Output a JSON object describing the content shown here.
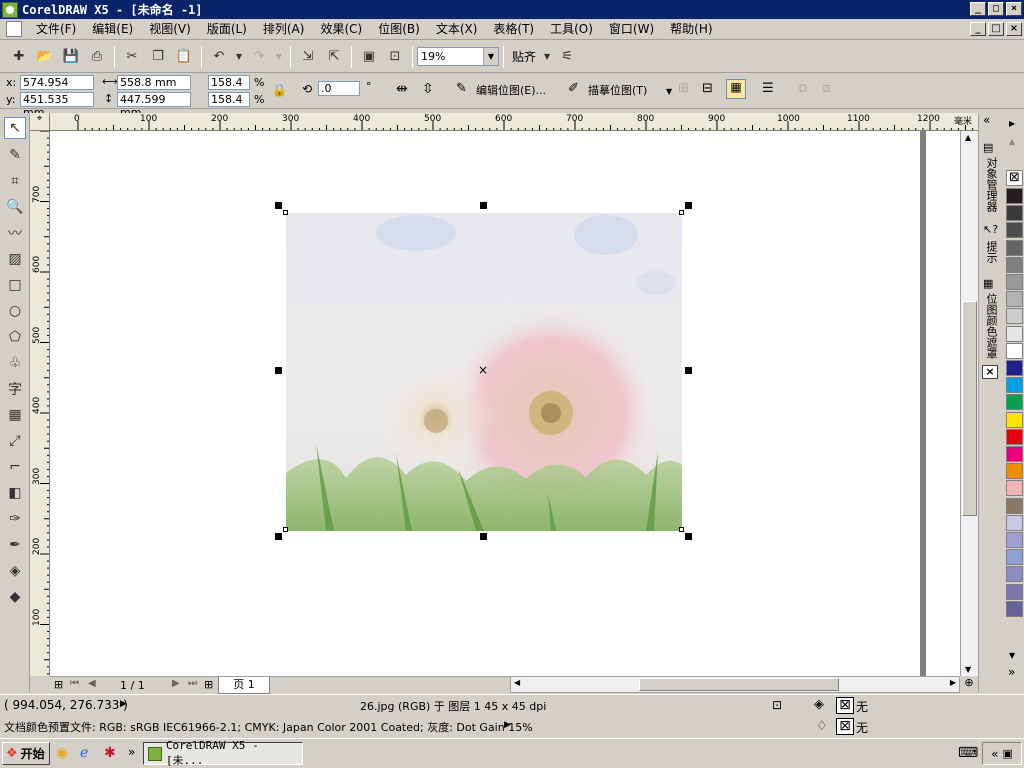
{
  "title_bar": {
    "text": "CorelDRAW X5 - [未命名 -1]"
  },
  "window_controls": {
    "minimize": "_",
    "maximize": "□",
    "close": "×"
  },
  "menu": [
    "文件(F)",
    "编辑(E)",
    "视图(V)",
    "版面(L)",
    "排列(A)",
    "效果(C)",
    "位图(B)",
    "文本(X)",
    "表格(T)",
    "工具(O)",
    "窗口(W)",
    "帮助(H)"
  ],
  "toolbar": {
    "zoom": "19%",
    "snap_label": "贴齐"
  },
  "properties": {
    "x_label": "x:",
    "x_value": "574.954 mm",
    "y_label": "y:",
    "y_value": "451.535 mm",
    "w_value": "558.8 mm",
    "h_value": "447.599 mm",
    "scale_w": "158.4",
    "scale_h": "158.4",
    "percent": "%",
    "rotation": ".0",
    "degree": "°",
    "edit_bitmap": "编辑位图(E)...",
    "trace_bitmap": "描摹位图(T)"
  },
  "ruler": {
    "top_ticks": [
      "0",
      "100",
      "200",
      "300",
      "400",
      "500",
      "600",
      "700",
      "800",
      "900",
      "1000",
      "1100",
      "1200"
    ],
    "top_unit": "毫米",
    "left_ticks": [
      "700",
      "600",
      "500",
      "400",
      "300",
      "200",
      "100"
    ]
  },
  "docker": {
    "tab_object_manager": "对象管理器",
    "tab_hints": "提示",
    "tab_bitmap_mask": "位图颜色遮罩"
  },
  "palette_colors": [
    "#ffffff",
    "#231f20",
    "#3a3a3a",
    "#4d4d4d",
    "#666666",
    "#7f7f7f",
    "#999999",
    "#b3b3b3",
    "#cccccc",
    "#e6e6e6",
    "#ffffff",
    "#1e1e8c",
    "#00a0e6",
    "#00a050",
    "#ffe600",
    "#e60012",
    "#e6007e",
    "#f08c00",
    "#f0b4b4",
    "#8c7864",
    "#c8c8e6",
    "#a0a0d2",
    "#8ca0d2",
    "#8c8cbe",
    "#7878aa",
    "#646496"
  ],
  "page_nav": {
    "page_counter": "1 / 1",
    "page_tab": "页 1"
  },
  "status": {
    "coords": "( 994.054, 276.733 )",
    "object_info": "26.jpg (RGB) 于 图层 1 45 x 45 dpi",
    "color_profile": "文档颜色预置文件: RGB: sRGB IEC61966-2.1; CMYK: Japan Color 2001 Coated; 灰度: Dot Gain 15%",
    "fill_none": "无",
    "outline_none": "无"
  },
  "taskbar": {
    "start": "开始",
    "task": "CorelDRAW X5 - [未...",
    "tray_arrow": "«"
  }
}
